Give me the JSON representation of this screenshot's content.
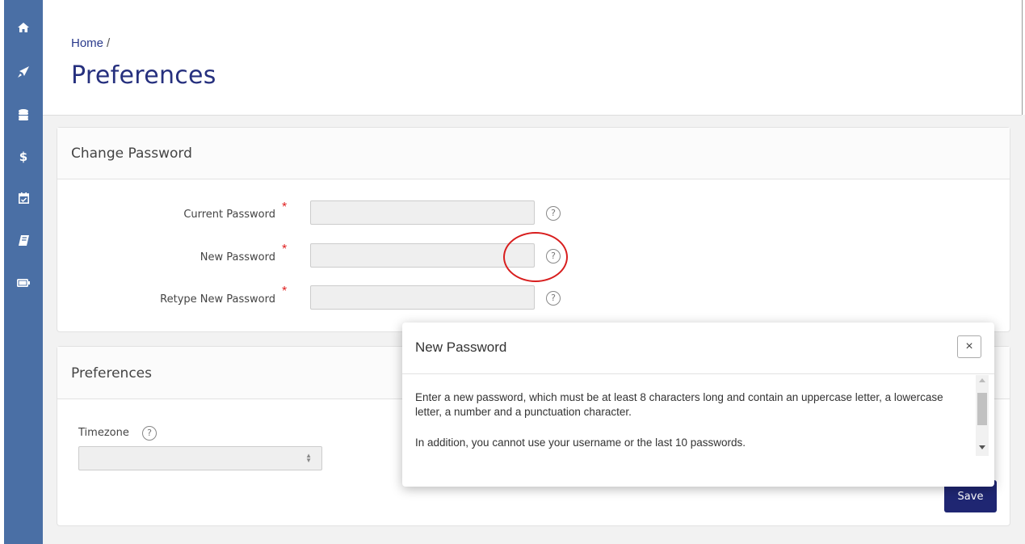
{
  "sidebar": {
    "items": [
      {
        "icon": "home-icon"
      },
      {
        "icon": "rocket-icon"
      },
      {
        "icon": "database-icon"
      },
      {
        "icon": "dollar-icon"
      },
      {
        "icon": "calendar-check-icon"
      },
      {
        "icon": "book-icon"
      },
      {
        "icon": "battery-icon"
      }
    ]
  },
  "header": {
    "breadcrumb_home": "Home",
    "breadcrumb_sep": "/",
    "title": "Preferences"
  },
  "change_password": {
    "title": "Change Password",
    "fields": [
      {
        "label": "Current Password",
        "required": "*",
        "help": "?"
      },
      {
        "label": "New Password",
        "required": "*",
        "help": "?"
      },
      {
        "label": "Retype New Password",
        "required": "*",
        "help": "?"
      }
    ]
  },
  "preferences": {
    "title": "Preferences",
    "timezone_label": "Timezone",
    "timezone_help": "?",
    "timezone_value": "",
    "save_label": "Save"
  },
  "popover": {
    "title": "New Password",
    "close": "×",
    "paragraphs": [
      "Enter a new password, which must be at least 8 characters long and contain an uppercase letter, a lowercase letter, a number and a punctuation character.",
      "In addition, you cannot use your username or the last 10 passwords."
    ]
  },
  "colors": {
    "sidebar": "#4a6fa5",
    "title": "#26307e",
    "primary_button": "#1f2672",
    "required": "#e02020",
    "highlight": "#d81e1e"
  }
}
